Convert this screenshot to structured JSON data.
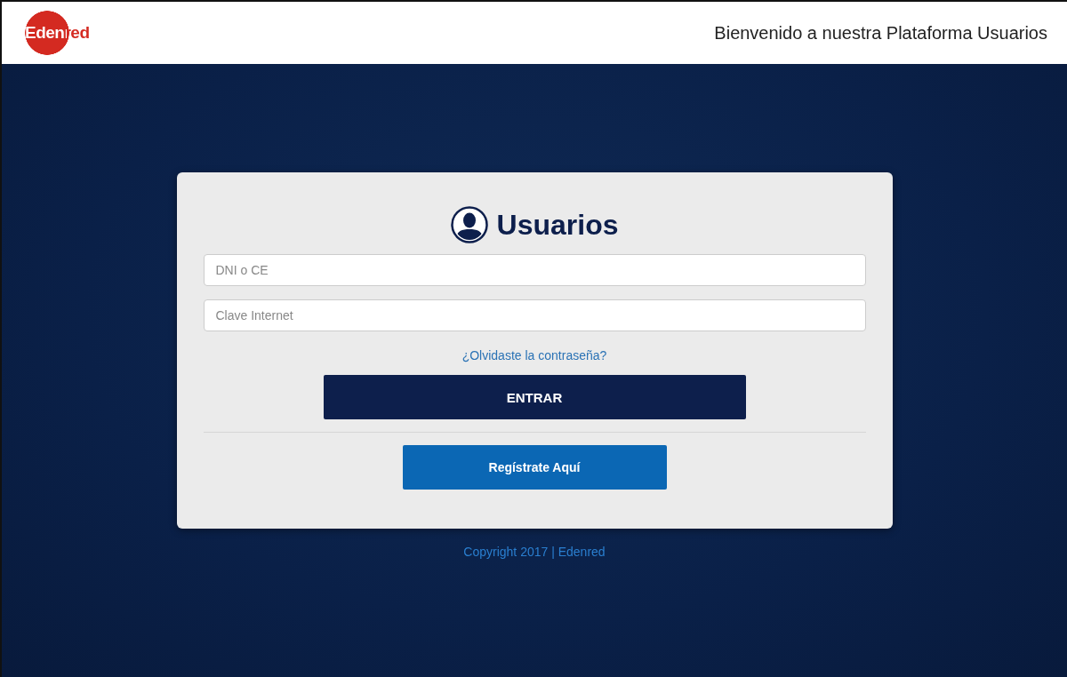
{
  "header": {
    "logo": "Edenred",
    "welcome": "Bienvenido a nuestra Plataforma Usuarios"
  },
  "login": {
    "title": "Usuarios",
    "fields": [
      {
        "placeholder": "DNI o CE"
      },
      {
        "placeholder": "Clave Internet"
      }
    ],
    "forgot_link": "¿Olvidaste la contraseña?",
    "submit_button": "ENTRAR",
    "register_button": "Regístrate Aquí"
  },
  "footer": {
    "copyright": "Copyright 2017 | Edenred"
  }
}
